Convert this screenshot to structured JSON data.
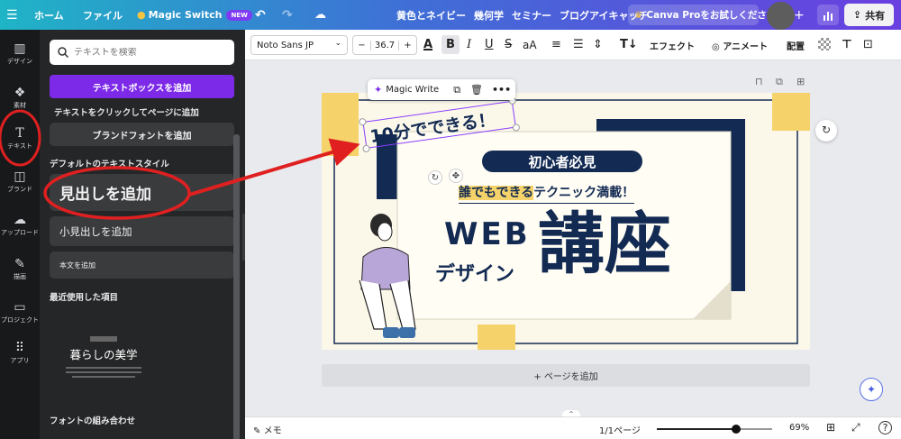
{
  "topbar": {
    "menu_icon": "hamburger-icon",
    "home": "ホーム",
    "file": "ファイル",
    "magic_switch": "Magic Switch",
    "magic_switch_badge": "NEW",
    "title_parts": [
      "黄色とネイビー",
      "幾何学",
      "セミナー",
      "ブログアイキャッチ"
    ],
    "pro_button": "Canva Proをお試しください",
    "share": "共有"
  },
  "rail": [
    {
      "label": "デザイン",
      "icon": "layout-icon"
    },
    {
      "label": "素材",
      "icon": "elements-icon"
    },
    {
      "label": "テキスト",
      "icon": "text-icon"
    },
    {
      "label": "ブランド",
      "icon": "brand-icon"
    },
    {
      "label": "アップロード",
      "icon": "upload-icon"
    },
    {
      "label": "描画",
      "icon": "draw-icon"
    },
    {
      "label": "プロジェクト",
      "icon": "folder-icon"
    },
    {
      "label": "アプリ",
      "icon": "apps-icon"
    }
  ],
  "panel": {
    "search_placeholder": "テキストを検索",
    "add_textbox": "テキストボックスを追加",
    "click_hint": "テキストをクリックしてページに追加",
    "brand_fonts": "ブランドフォントを追加",
    "default_styles_heading": "デフォルトのテキストスタイル",
    "heading": "見出しを追加",
    "subheading": "小見出しを追加",
    "body": "本文を追加",
    "recent_heading": "最近使用した項目",
    "recent_sample": "暮らしの美学",
    "font_combos_heading": "フォントの組み合わせ"
  },
  "toolbar": {
    "font": "Noto Sans JP",
    "font_size": "36.7",
    "minus": "−",
    "plus": "+",
    "effects": "エフェクト",
    "animate": "アニメート",
    "position": "配置"
  },
  "canvas": {
    "magic_write": "Magic Write",
    "add_page": "+ ページを追加",
    "design": {
      "callout": "10分でできる！",
      "badge": "初心者必見",
      "tagline_highlight": "誰でもできる",
      "tagline_rest": "テクニック満載！",
      "web": "WEB",
      "design": "デザイン",
      "kouza": "講座"
    }
  },
  "bottombar": {
    "notes": "メモ",
    "pages": "1/1ページ",
    "zoom": "69%",
    "zoom_level": 0.69
  },
  "colors": {
    "navy": "#132a53",
    "yellow": "#f5d36a",
    "purple": "#7d2ae8",
    "annotation_red": "#e02020",
    "page_bg": "#fbf8ea"
  }
}
